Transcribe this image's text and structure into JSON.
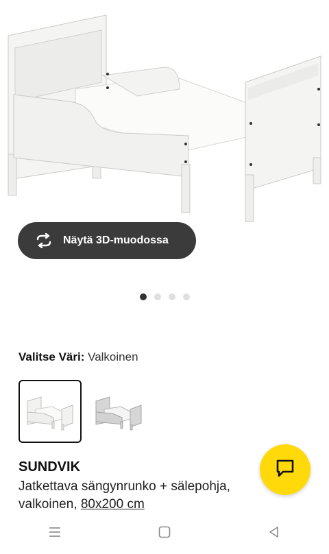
{
  "product": {
    "image_alt": "SUNDVIK bed",
    "view_3d_label": "Näytä 3D-muodossa",
    "carousel": {
      "count": 4,
      "active": 1
    },
    "color_label": "Valitse Väri:",
    "color_value": "Valkoinen",
    "swatches": [
      {
        "name": "valkoinen-swatch",
        "selected": true,
        "color": "#f0f0ee"
      },
      {
        "name": "harmaa-swatch",
        "selected": false,
        "color": "#cfcfcf"
      }
    ],
    "name": "SUNDVIK",
    "desc_line1": "Jatkettava sängynrunko + sälepohja,",
    "desc_line2_prefix": "valkoinen, ",
    "size_link": "80x200 cm"
  },
  "colors": {
    "chat_button": "#ffd90a",
    "dark_button": "#3b3b3b"
  },
  "icons": {
    "view_3d": "rotate-3d-icon",
    "chat": "chat-icon",
    "nav_menu": "menu-icon",
    "nav_home": "home-square-icon",
    "nav_back": "back-triangle-icon"
  }
}
